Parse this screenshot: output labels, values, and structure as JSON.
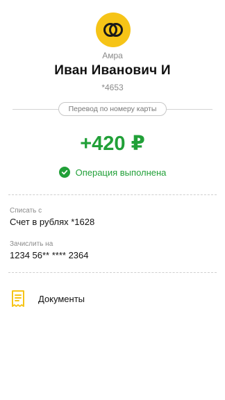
{
  "recipient": {
    "bank_name": "Амра",
    "name": "Иван Иванович И",
    "card_mask": "*4653"
  },
  "transfer": {
    "type_label": "Перевод по номеру карты",
    "amount": "+420 ₽",
    "status": "Операция выполнена"
  },
  "details": {
    "debit_label": "Списать с",
    "debit_value": "Счет в рублях *1628",
    "credit_label": "Зачислить на",
    "credit_value": "1234 56** **** 2364"
  },
  "documents": {
    "label": "Документы",
    "icon": "receipt-icon"
  },
  "colors": {
    "accent_green": "#21a038",
    "logo_yellow": "#f6c417",
    "muted_text": "#8a8a8a"
  }
}
